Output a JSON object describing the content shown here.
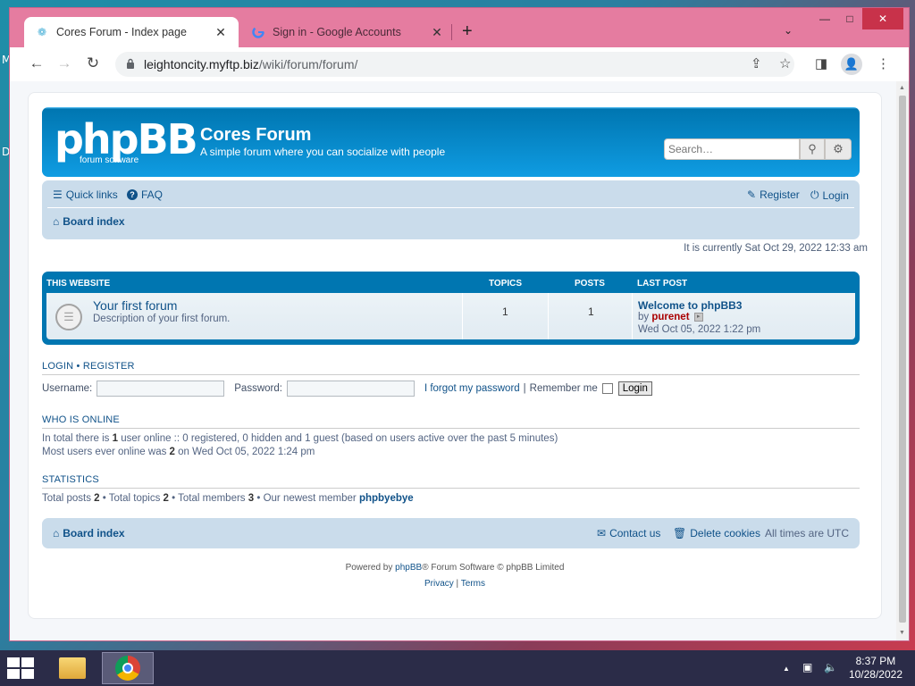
{
  "desktop": {
    "letters": [
      "M",
      "D"
    ]
  },
  "browser": {
    "tabs": [
      {
        "title": "Cores Forum - Index page",
        "favicon": "phpbb-favicon",
        "close": "✕"
      },
      {
        "title": "Sign in - Google Accounts",
        "favicon": "google-icon",
        "close": "✕"
      }
    ],
    "new_tab": "+",
    "tab_dropdown": "⌄",
    "window": {
      "minimize": "—",
      "maximize": "□",
      "close": "✕"
    },
    "nav": {
      "back": "←",
      "forward": "→",
      "reload": "↻"
    },
    "url_host": "leightoncity.myftp.biz",
    "url_path": "/wiki/forum/forum/"
  },
  "forum": {
    "logo": {
      "main": "phpBB",
      "sub": "forum software"
    },
    "site_name": "Cores Forum",
    "site_description": "A simple forum where you can socialize with people",
    "search_placeholder": "Search…",
    "nav": {
      "quick_links": "Quick links",
      "faq": "FAQ",
      "register": "Register",
      "login": "Login",
      "board_index": "Board index"
    },
    "current_time": "It is currently Sat Oct 29, 2022 12:33 am",
    "category": {
      "title": "THIS WEBSITE",
      "col_topics": "TOPICS",
      "col_posts": "POSTS",
      "col_last_post": "LAST POST"
    },
    "forums": [
      {
        "title": "Your first forum",
        "description": "Description of your first forum.",
        "topics": "1",
        "posts": "1",
        "last_post_title": "Welcome to phpBB3",
        "last_post_by_label": "by",
        "last_post_author": "purenet",
        "last_post_date": "Wed Oct 05, 2022 1:22 pm"
      }
    ],
    "login": {
      "heading_login": "LOGIN",
      "heading_sep": "•",
      "heading_register": "REGISTER",
      "username_label": "Username:",
      "password_label": "Password:",
      "forgot": "I forgot my password",
      "pipe": "|",
      "remember": "Remember me",
      "button": "Login"
    },
    "online": {
      "heading": "WHO IS ONLINE",
      "line1_a": "In total there is ",
      "line1_count": "1",
      "line1_b": " user online :: 0 registered, 0 hidden and 1 guest (based on users active over the past 5 minutes)",
      "line2_a": "Most users ever online was ",
      "line2_count": "2",
      "line2_b": " on Wed Oct 05, 2022 1:24 pm"
    },
    "stats": {
      "heading": "STATISTICS",
      "posts_label": "Total posts ",
      "posts": "2",
      "topics_label": " • Total topics ",
      "topics": "2",
      "members_label": " • Total members ",
      "members": "3",
      "newest_label": " • Our newest member ",
      "newest": "phpbyebye"
    },
    "footer_nav": {
      "board_index": "Board index",
      "contact": "Contact us",
      "delete_cookies": "Delete cookies",
      "timezone": "All times are UTC"
    },
    "copyright": {
      "powered_by": "Powered by ",
      "phpbb": "phpBB",
      "rest": "® Forum Software © phpBB Limited",
      "privacy": "Privacy",
      "sep": " | ",
      "terms": "Terms"
    }
  },
  "taskbar": {
    "time": "8:37 PM",
    "date": "10/28/2022"
  },
  "colors": {
    "browser_frame": "#e57ca0",
    "header_blue": "#12a3eb",
    "nav_bg": "#cadceb",
    "link": "#105289",
    "author": "#aa0000"
  }
}
